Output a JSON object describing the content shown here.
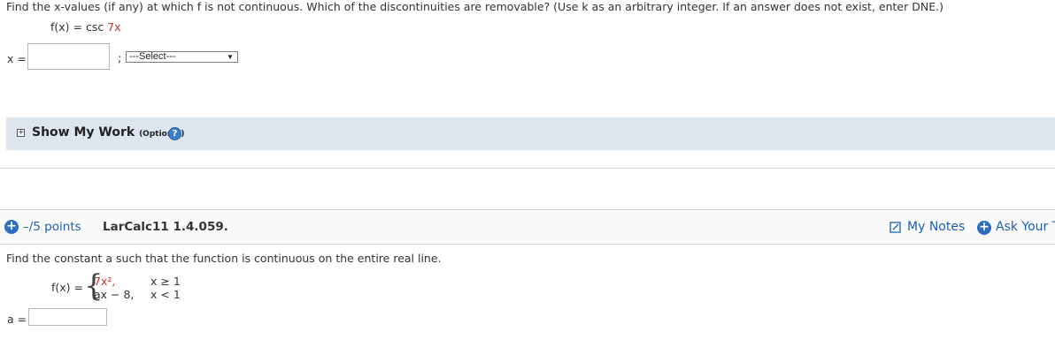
{
  "question1": {
    "instruction": "Find the x-values (if any) at which f is not continuous. Which of the discontinuities are removable? (Use k as an arbitrary integer. If an answer does not exist, enter DNE.)",
    "function_lhs": "f(x) = csc",
    "function_arg": "7x",
    "x_label": "x =",
    "x_value": "",
    "separator": ";",
    "select_value": "---Select---"
  },
  "show_my_work": {
    "label": "Show My Work",
    "optional": "(Optional)",
    "help": "?"
  },
  "question2": {
    "points": "–/5 points",
    "problem_id": "LarCalc11 1.4.059.",
    "my_notes": "My Notes",
    "ask": "Ask Your T",
    "instruction": "Find the constant a such that the function is continuous on the entire real line.",
    "fx_label": "f(x) =",
    "piece1_expr": "7x²,",
    "piece1_cond": "x ≥ 1",
    "piece2_expr": "ax − 8,",
    "piece2_cond": "x < 1",
    "a_label": "a =",
    "a_value": ""
  },
  "colors": {
    "accent": "#2d6fc2",
    "highlight": "#c0392b",
    "panel": "#dde6ef"
  }
}
